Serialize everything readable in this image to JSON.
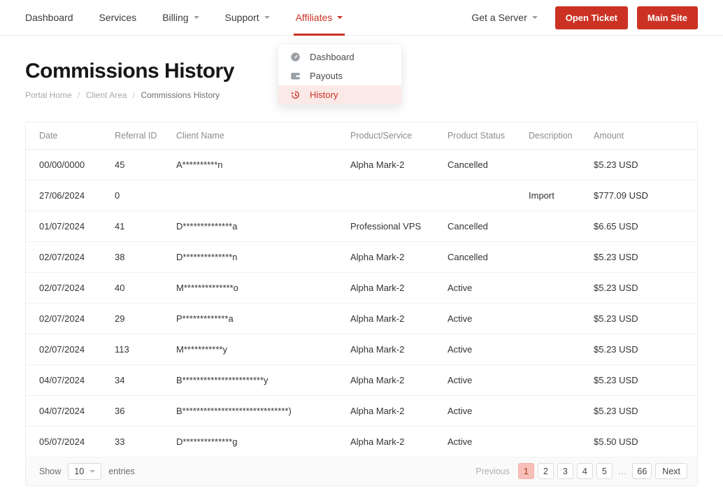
{
  "colors": {
    "accent": "#cc3224",
    "dropdown_active_bg": "#fbe9e7",
    "pagination_active_bg": "#f6c0b8"
  },
  "nav": {
    "items": [
      {
        "label": "Dashboard",
        "caret": false,
        "active": false
      },
      {
        "label": "Services",
        "caret": false,
        "active": false
      },
      {
        "label": "Billing",
        "caret": true,
        "active": false
      },
      {
        "label": "Support",
        "caret": true,
        "active": false
      },
      {
        "label": "Affiliates",
        "caret": true,
        "active": true
      }
    ],
    "get_server_label": "Get a Server",
    "open_ticket_label": "Open Ticket",
    "main_site_label": "Main Site"
  },
  "dropdown": {
    "items": [
      {
        "label": "Dashboard",
        "icon": "gauge-icon",
        "active": false
      },
      {
        "label": "Payouts",
        "icon": "wallet-icon",
        "active": false
      },
      {
        "label": "History",
        "icon": "history-icon",
        "active": true
      }
    ]
  },
  "page": {
    "title": "Commissions History",
    "breadcrumb": [
      "Portal Home",
      "Client Area",
      "Commissions History"
    ],
    "separator": "/"
  },
  "table": {
    "columns": [
      "Date",
      "Referral ID",
      "Client Name",
      "Product/Service",
      "Product Status",
      "Description",
      "Amount"
    ],
    "rows": [
      {
        "date": "00/00/0000",
        "referral_id": "45",
        "client_name": "A**********n",
        "product": "Alpha Mark-2",
        "status": "Cancelled",
        "description": "",
        "amount": "$5.23 USD"
      },
      {
        "date": "27/06/2024",
        "referral_id": "0",
        "client_name": "",
        "product": "",
        "status": "",
        "description": "Import",
        "amount": "$777.09 USD"
      },
      {
        "date": "01/07/2024",
        "referral_id": "41",
        "client_name": "D**************a",
        "product": "Professional VPS",
        "status": "Cancelled",
        "description": "",
        "amount": "$6.65 USD"
      },
      {
        "date": "02/07/2024",
        "referral_id": "38",
        "client_name": "D**************n",
        "product": "Alpha Mark-2",
        "status": "Cancelled",
        "description": "",
        "amount": "$5.23 USD"
      },
      {
        "date": "02/07/2024",
        "referral_id": "40",
        "client_name": "M**************o",
        "product": "Alpha Mark-2",
        "status": "Active",
        "description": "",
        "amount": "$5.23 USD"
      },
      {
        "date": "02/07/2024",
        "referral_id": "29",
        "client_name": "P*************a",
        "product": "Alpha Mark-2",
        "status": "Active",
        "description": "",
        "amount": "$5.23 USD"
      },
      {
        "date": "02/07/2024",
        "referral_id": "113",
        "client_name": "M***********y",
        "product": "Alpha Mark-2",
        "status": "Active",
        "description": "",
        "amount": "$5.23 USD"
      },
      {
        "date": "04/07/2024",
        "referral_id": "34",
        "client_name": "B***********************y",
        "product": "Alpha Mark-2",
        "status": "Active",
        "description": "",
        "amount": "$5.23 USD"
      },
      {
        "date": "04/07/2024",
        "referral_id": "36",
        "client_name": "B******************************)",
        "product": "Alpha Mark-2",
        "status": "Active",
        "description": "",
        "amount": "$5.23 USD"
      },
      {
        "date": "05/07/2024",
        "referral_id": "33",
        "client_name": "D**************g",
        "product": "Alpha Mark-2",
        "status": "Active",
        "description": "",
        "amount": "$5.50 USD"
      }
    ]
  },
  "footer": {
    "show_label": "Show",
    "page_size": "10",
    "entries_label": "entries",
    "pagination": {
      "previous": "Previous",
      "pages": [
        "1",
        "2",
        "3",
        "4",
        "5",
        "…",
        "66"
      ],
      "active": "1",
      "next": "Next"
    }
  }
}
